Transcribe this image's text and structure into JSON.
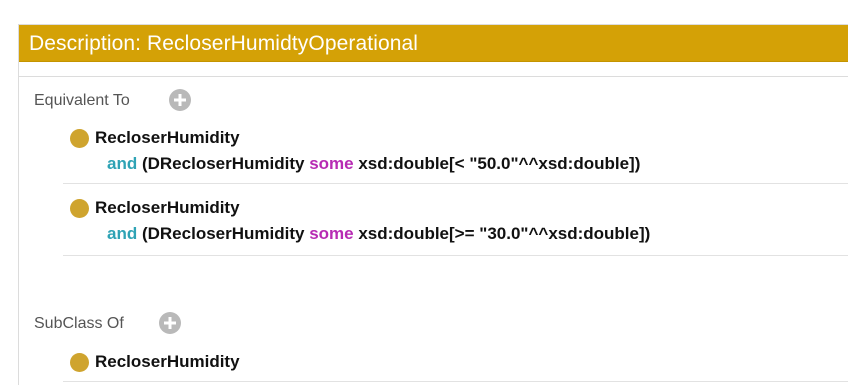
{
  "header": {
    "title": "Description: RecloserHumidtyOperational"
  },
  "sections": {
    "equivalent_to": {
      "label": "Equivalent To",
      "entries": [
        {
          "class_name": "RecloserHumidity",
          "kw_and": "and",
          "prop_open": "(DRecloserHumidity",
          "kw_some": "some",
          "restriction": "xsd:double[< \"50.0\"^^xsd:double])"
        },
        {
          "class_name": "RecloserHumidity",
          "kw_and": "and",
          "prop_open": "(DRecloserHumidity",
          "kw_some": "some",
          "restriction": "xsd:double[>= \"30.0\"^^xsd:double])"
        }
      ]
    },
    "subclass_of": {
      "label": "SubClass Of",
      "entries": [
        {
          "class_name": "RecloserHumidity"
        }
      ]
    }
  },
  "colors": {
    "header_bg": "#d4a106",
    "bullet": "#cfa42e",
    "keyword_and": "#2ea3b5",
    "keyword_some": "#b72bb3",
    "add_button": "#b9b9b9"
  },
  "icons": {
    "add": "plus-circle-icon",
    "class_bullet": "class-circle-icon"
  }
}
